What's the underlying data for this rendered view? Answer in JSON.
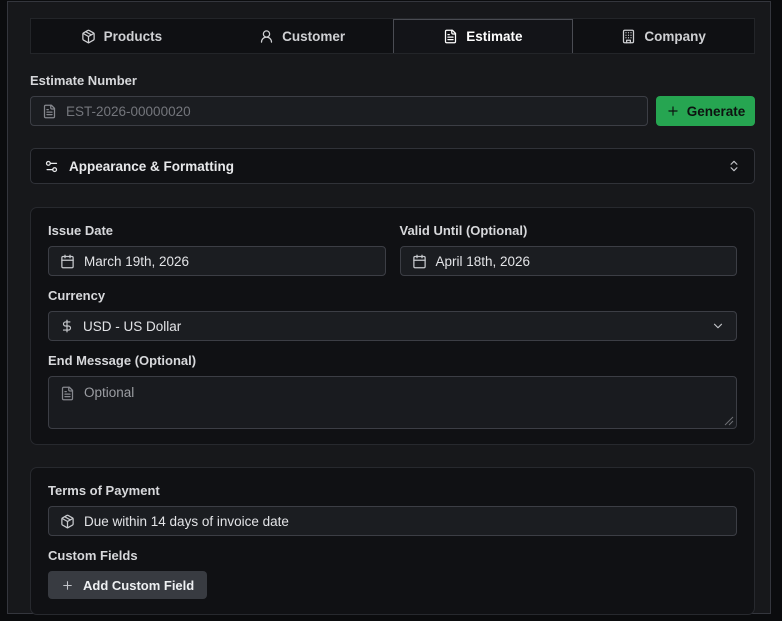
{
  "tabs": [
    {
      "label": "Products",
      "icon": "package-icon",
      "active": false
    },
    {
      "label": "Customer",
      "icon": "user-icon",
      "active": false
    },
    {
      "label": "Estimate",
      "icon": "file-text-icon",
      "active": true
    },
    {
      "label": "Company",
      "icon": "building-icon",
      "active": false
    }
  ],
  "estimate_number": {
    "label": "Estimate Number",
    "placeholder": "EST-2026-00000020",
    "generate_label": "Generate"
  },
  "appearance": {
    "label": "Appearance & Formatting"
  },
  "details": {
    "issue_date": {
      "label": "Issue Date",
      "value": "March 19th, 2026"
    },
    "valid_until": {
      "label": "Valid Until (Optional)",
      "value": "April 18th, 2026"
    },
    "currency": {
      "label": "Currency",
      "value": "USD - US Dollar"
    },
    "end_message": {
      "label": "End Message (Optional)",
      "placeholder": "Optional"
    }
  },
  "payment": {
    "terms": {
      "label": "Terms of Payment",
      "value": "Due within 14 days of invoice date"
    },
    "custom_fields": {
      "label": "Custom Fields",
      "add_button_label": "Add Custom Field"
    }
  },
  "icons": {
    "package-icon": "3d cube package",
    "user-icon": "person silhouette",
    "file-text-icon": "document with text lines",
    "building-icon": "office building with windows",
    "plus-icon": "+",
    "settings-sliders-icon": "two sliders with knobs",
    "chevrons-up-down-icon": "stacked up and down chevrons",
    "calendar-icon": "calendar grid",
    "dollar-icon": "$",
    "chevron-down-icon": "v",
    "resize-grip-icon": "diagonal resize lines"
  },
  "colors": {
    "accent_green": "#26a551",
    "panel_bg": "#17181b",
    "card_bg": "#101114",
    "input_bg": "#1b1d21",
    "border": "#3c3e45"
  }
}
